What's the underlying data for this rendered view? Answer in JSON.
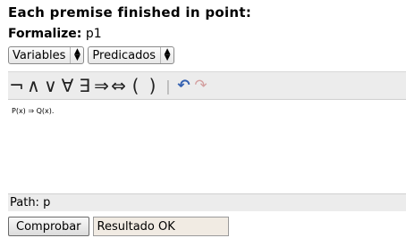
{
  "header": {
    "title": "Each premise finished in point:"
  },
  "formalize": {
    "label": "Formalize:",
    "value": "p1"
  },
  "selects": {
    "variables": "Variables",
    "predicados": "Predicados"
  },
  "toolbar": {
    "symbols": [
      "¬",
      "∧",
      "∨",
      "∀",
      "∃",
      "⇒",
      "⇔",
      "(",
      ")"
    ],
    "separator": "|",
    "undo": "↶",
    "redo": "↷"
  },
  "editor": {
    "content": "P(x) ⇒ Q(x)."
  },
  "path": {
    "text": "Path: p"
  },
  "actions": {
    "check_label": "Comprobar",
    "result_text": "Resultado OK"
  }
}
